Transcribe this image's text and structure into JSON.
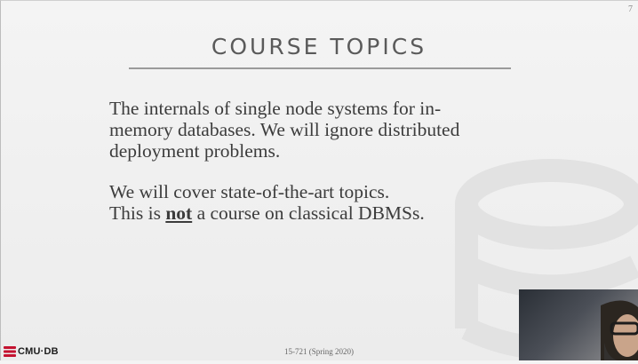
{
  "slide": {
    "page_number": "7",
    "title": "COURSE TOPICS",
    "paragraphs": [
      {
        "lines": [
          "The internals of single node systems for in-",
          "memory databases. We will ignore distributed",
          "deployment problems."
        ]
      },
      {
        "line1": "We will cover state-of-the-art topics.",
        "line2_prefix": "This is ",
        "line2_emphasis": "not",
        "line2_suffix": " a course on classical DBMSs."
      }
    ],
    "footer": {
      "logo_text": "CMU·DB",
      "course_label": "15-721 (Spring 2020)"
    }
  },
  "colors": {
    "title": "#5a5a5a",
    "body_text": "#3c3c3c",
    "logo_red": "#c41230"
  },
  "icons": {
    "footer_logo": "cmu-db-logo-icon",
    "background": "database-cylinder-watermark-icon"
  }
}
